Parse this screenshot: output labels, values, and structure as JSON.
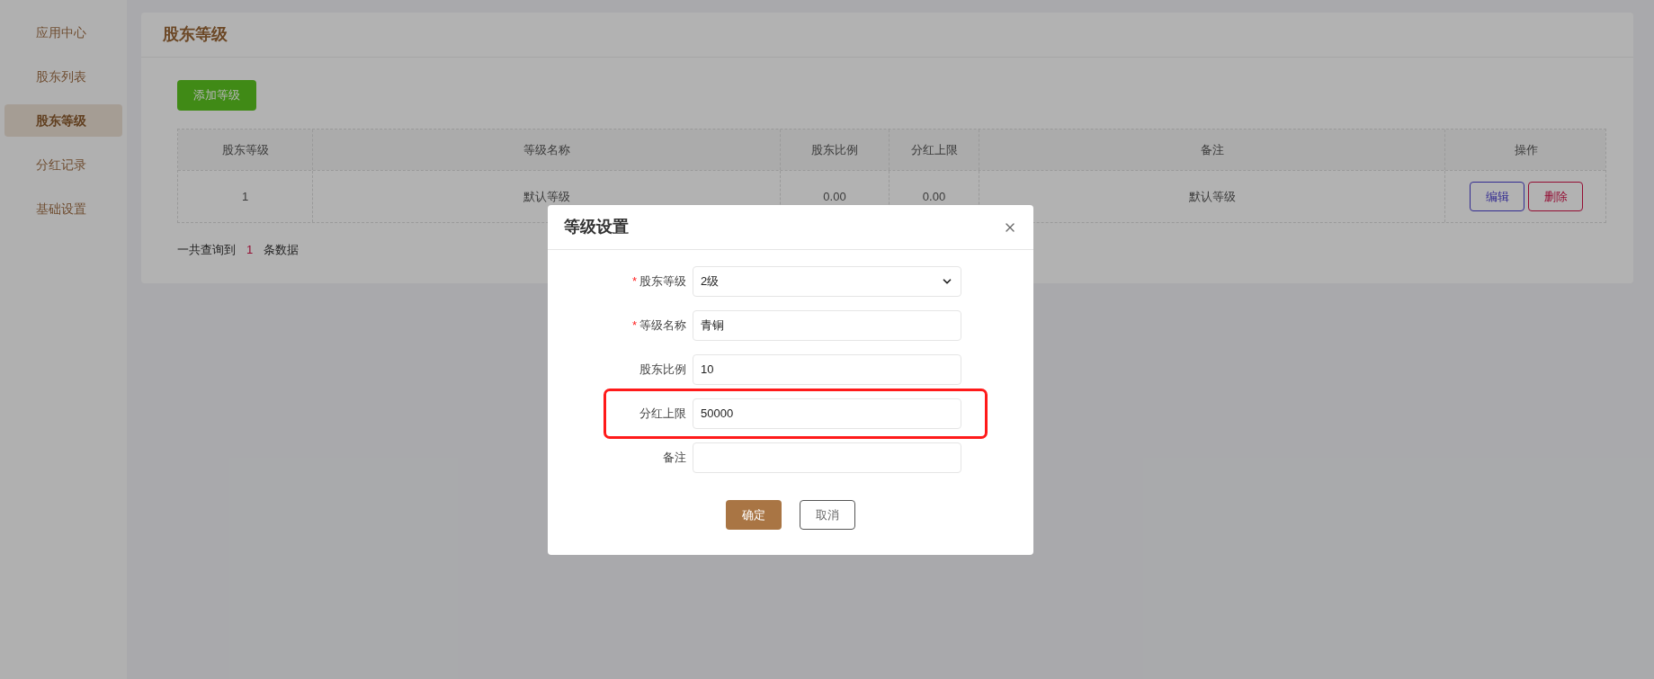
{
  "sidebar": {
    "items": [
      {
        "label": "应用中心",
        "selected": false
      },
      {
        "label": "股东列表",
        "selected": false
      },
      {
        "label": "股东等级",
        "selected": true
      },
      {
        "label": "分红记录",
        "selected": false
      },
      {
        "label": "基础设置",
        "selected": false
      }
    ]
  },
  "page_title": "股东等级",
  "add_button": "添加等级",
  "table": {
    "columns": [
      "股东等级",
      "等级名称",
      "股东比例",
      "分红上限",
      "备注",
      "操作"
    ],
    "rows": [
      {
        "cells": [
          "1",
          "默认等级",
          "0.00",
          "0.00",
          "默认等级"
        ],
        "actions": [
          {
            "label": "编辑",
            "kind": "edit"
          },
          {
            "label": "删除",
            "kind": "delete"
          }
        ]
      }
    ]
  },
  "summary": {
    "prefix": "一共查询到",
    "count": "1",
    "suffix": "条数据"
  },
  "modal": {
    "title": "等级设置",
    "fields": [
      {
        "label": "股东等级",
        "required_mark": "*",
        "kind": "select",
        "value": "2级",
        "highlighted": false
      },
      {
        "label": "等级名称",
        "required_mark": "*",
        "kind": "input",
        "value": "青铜",
        "highlighted": false
      },
      {
        "label": "股东比例",
        "kind": "input",
        "value": "10",
        "highlighted": false
      },
      {
        "label": "分红上限",
        "kind": "input",
        "value": "50000",
        "highlighted": true
      },
      {
        "label": "备注",
        "kind": "input",
        "highlighted": false
      }
    ],
    "buttons": [
      {
        "label": "确定",
        "kind": "primary"
      },
      {
        "label": "取消",
        "kind": "default"
      }
    ]
  }
}
